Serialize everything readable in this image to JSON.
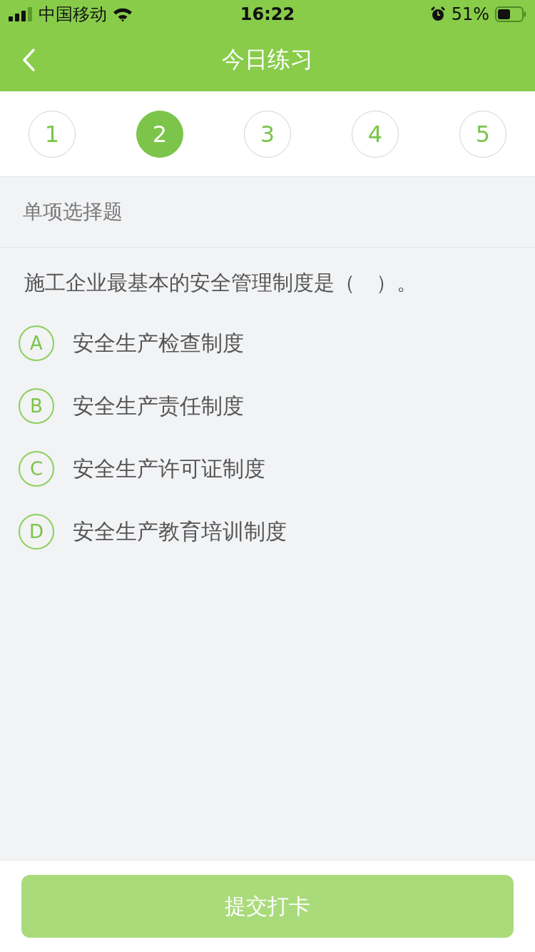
{
  "status_bar": {
    "carrier": "中国移动",
    "time": "16:22",
    "battery": "51%"
  },
  "nav": {
    "title": "今日练习"
  },
  "questions": [
    {
      "label": "1",
      "selected": false
    },
    {
      "label": "2",
      "selected": true
    },
    {
      "label": "3",
      "selected": false
    },
    {
      "label": "4",
      "selected": false
    },
    {
      "label": "5",
      "selected": false
    }
  ],
  "section": {
    "title": "单项选择题"
  },
  "question": {
    "text": "施工企业最基本的安全管理制度是（　）。"
  },
  "options": [
    {
      "letter": "A",
      "text": "安全生产检查制度",
      "selected": false
    },
    {
      "letter": "B",
      "text": "安全生产责任制度",
      "selected": false
    },
    {
      "letter": "C",
      "text": "安全生产许可证制度",
      "selected": false
    },
    {
      "letter": "D",
      "text": "安全生产教育培训制度",
      "selected": false
    }
  ],
  "submit": {
    "label": "提交打卡",
    "disabled": true
  }
}
